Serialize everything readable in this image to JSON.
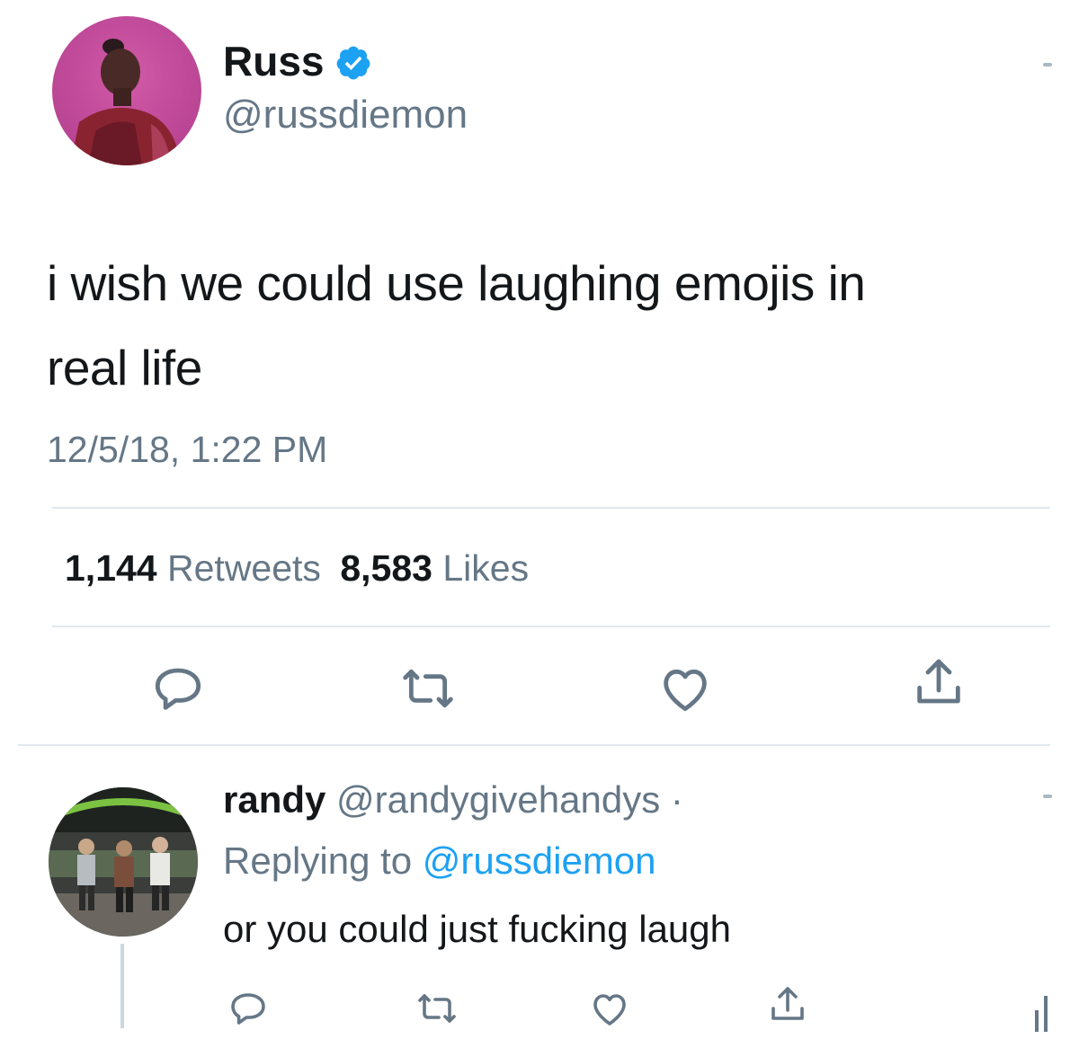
{
  "tweet": {
    "author": {
      "display_name": "Russ",
      "handle": "@russdiemon",
      "verified": true,
      "verified_color": "#1da1f2"
    },
    "text_line1": "i wish we could use laughing emojis in",
    "text_line2": "real life",
    "timestamp": "12/5/18, 1:22 PM",
    "retweet_count": "1,144",
    "retweet_label": "Retweets",
    "like_count": "8,583",
    "like_label": "Likes",
    "actions": [
      "reply-icon",
      "retweet-icon",
      "like-icon",
      "share-icon"
    ]
  },
  "reply": {
    "author": {
      "display_name": "randy",
      "handle": "@randygivehandys",
      "separator": "·"
    },
    "replying_prefix": "Replying to",
    "replying_to": "@russdiemon",
    "text": "or you could just fucking laugh",
    "actions": [
      "reply-icon",
      "retweet-icon",
      "like-icon",
      "share-icon",
      "analytics-icon"
    ]
  },
  "colors": {
    "text_primary": "#14171a",
    "text_secondary": "#657786",
    "link": "#1da1f2",
    "divider": "#e1e8ed"
  }
}
